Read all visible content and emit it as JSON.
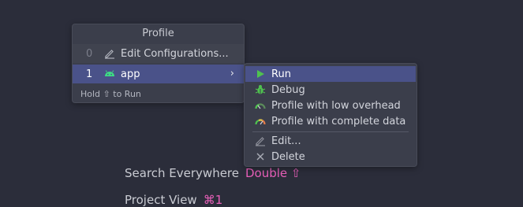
{
  "profile_popup": {
    "title": "Profile",
    "items": [
      {
        "mnemonic": "0",
        "icon": "pencil-icon",
        "label": "Edit Configurations..."
      },
      {
        "mnemonic": "1",
        "icon": "android-icon",
        "label": "app",
        "chevron": "›"
      }
    ],
    "hint": "Hold ⇧ to Run"
  },
  "submenu": {
    "items": [
      {
        "icon": "run-icon",
        "label": "Run"
      },
      {
        "icon": "debug-icon",
        "label": "Debug"
      },
      {
        "icon": "profiler-low-icon",
        "label": "Profile with low overhead"
      },
      {
        "icon": "profiler-full-icon",
        "label": "Profile with complete data"
      },
      {
        "icon": "pencil-icon",
        "label": "Edit..."
      },
      {
        "icon": "close-icon",
        "label": "Delete"
      }
    ]
  },
  "background_hints": {
    "search_everywhere": {
      "label": "Search Everywhere",
      "shortcut": "Double ⇧"
    },
    "project_view": {
      "label": "Project View",
      "shortcut": "⌘1"
    }
  },
  "colors": {
    "background": "#2b2d3a",
    "popup": "#3b3e4b",
    "selection": "#4a5289",
    "shortcut_accent": "#e85fb9",
    "run_green": "#4fc24f"
  }
}
